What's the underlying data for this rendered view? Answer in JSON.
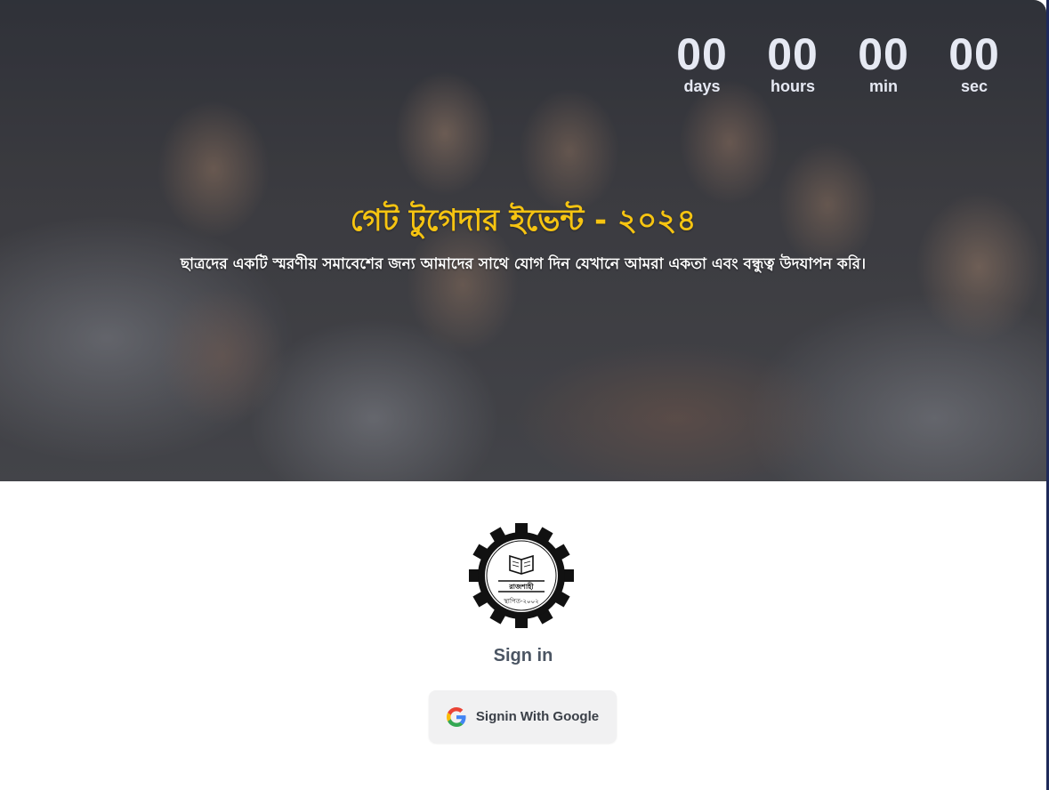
{
  "countdown": {
    "units": [
      {
        "value": "00",
        "label": "days"
      },
      {
        "value": "00",
        "label": "hours"
      },
      {
        "value": "00",
        "label": "min"
      },
      {
        "value": "00",
        "label": "sec"
      }
    ]
  },
  "hero": {
    "title": "গেট টুগেদার ইভেন্ট - ২০২৪",
    "subtitle": "ছাত্রদের একটি স্মরণীয় সমাবেশের জন্য আমাদের সাথে যোগ দিন যেখানে আমরা একতা এবং বন্ধুত্ব উদযাপন করি।",
    "title_color": "#f6c411"
  },
  "logo": {
    "icon": "gear-book-seal",
    "arc_text": "বাংলাদেশ পলিটেকনিক ইনস্টিটিউট",
    "city": "রাজশাহী",
    "established": "স্থাপিত-২০০২"
  },
  "auth": {
    "title": "Sign in",
    "google_button_label": "Signin With Google",
    "google_icon": "google-g-icon"
  }
}
